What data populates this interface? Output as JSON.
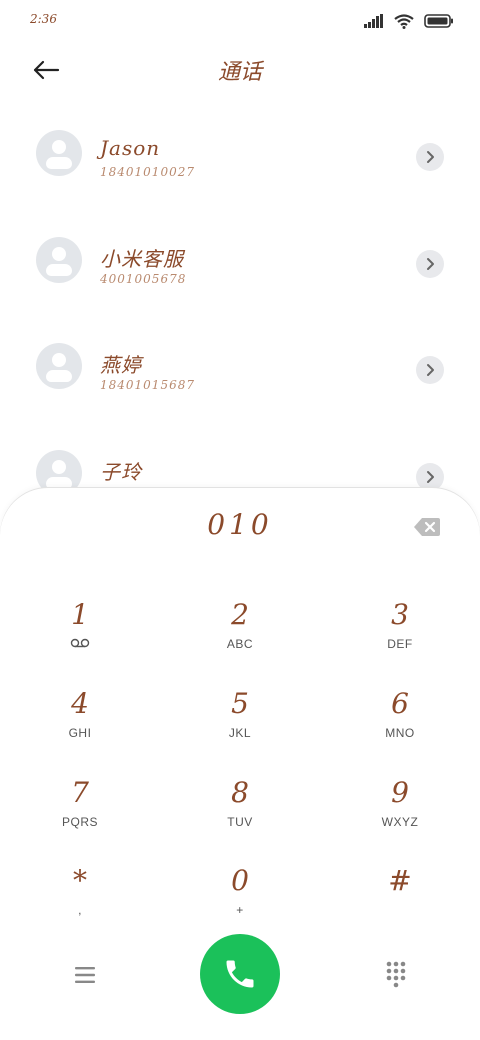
{
  "status": {
    "time": "2:36"
  },
  "header": {
    "title": "通话"
  },
  "contacts": [
    {
      "name": "Jason",
      "phone": "18401010027"
    },
    {
      "name": "小米客服",
      "phone": "4001005678"
    },
    {
      "name": "燕婷",
      "phone": "18401015687"
    },
    {
      "name": "子玲",
      "phone": ""
    }
  ],
  "dialer": {
    "input": "010",
    "keys": [
      {
        "digit": "1",
        "letters": ""
      },
      {
        "digit": "2",
        "letters": "ABC"
      },
      {
        "digit": "3",
        "letters": "DEF"
      },
      {
        "digit": "4",
        "letters": "GHI"
      },
      {
        "digit": "5",
        "letters": "JKL"
      },
      {
        "digit": "6",
        "letters": "MNO"
      },
      {
        "digit": "7",
        "letters": "PQRS"
      },
      {
        "digit": "8",
        "letters": "TUV"
      },
      {
        "digit": "9",
        "letters": "WXYZ"
      },
      {
        "digit": "*",
        "letters": ","
      },
      {
        "digit": "0",
        "letters": "+"
      },
      {
        "digit": "#",
        "letters": ""
      }
    ]
  },
  "colors": {
    "accent": "#8b4a2b",
    "call": "#1bc15a"
  },
  "icons": [
    "signal-icon",
    "wifi-icon",
    "battery-icon",
    "back-arrow-icon",
    "chevron-right-icon",
    "voicemail-icon",
    "backspace-icon",
    "menu-icon",
    "phone-icon",
    "dialpad-icon"
  ]
}
